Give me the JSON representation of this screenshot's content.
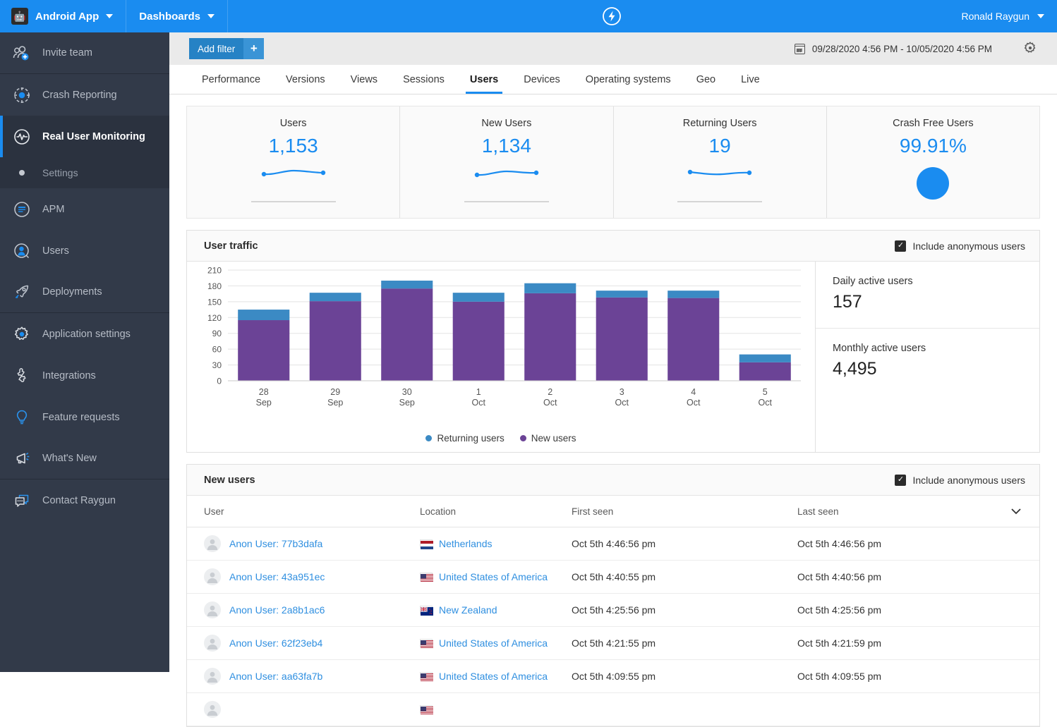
{
  "topbar": {
    "app_name": "Android App",
    "dashboards_label": "Dashboards",
    "user_name": "Ronald Raygun",
    "brand_color": "#1a8cf0"
  },
  "sidebar": {
    "invite": {
      "label": "Invite team",
      "icon": "invite-team-icon"
    },
    "items": [
      {
        "label": "Crash Reporting",
        "icon": "crash-reporting-icon",
        "active": false
      },
      {
        "label": "Real User Monitoring",
        "icon": "rum-icon",
        "active": true
      },
      {
        "label": "Settings",
        "icon": "dot-icon",
        "active": false,
        "sub": true
      },
      {
        "label": "APM",
        "icon": "apm-icon",
        "active": false
      },
      {
        "label": "Users",
        "icon": "users-icon",
        "active": false
      },
      {
        "label": "Deployments",
        "icon": "rocket-icon",
        "active": false
      },
      {
        "label": "Application settings",
        "icon": "gear-icon",
        "active": false
      },
      {
        "label": "Integrations",
        "icon": "puzzle-icon",
        "active": false
      },
      {
        "label": "Feature requests",
        "icon": "lightbulb-icon",
        "active": false
      },
      {
        "label": "What's New",
        "icon": "megaphone-icon",
        "active": false
      },
      {
        "label": "Contact Raygun",
        "icon": "chat-icon",
        "active": false
      }
    ]
  },
  "filterbar": {
    "add_filter_label": "Add filter",
    "add_filter_plus": "+",
    "date_range": "09/28/2020 4:56 PM - 10/05/2020 4:56 PM"
  },
  "tabs": [
    {
      "label": "Performance",
      "active": false
    },
    {
      "label": "Versions",
      "active": false
    },
    {
      "label": "Views",
      "active": false
    },
    {
      "label": "Sessions",
      "active": false
    },
    {
      "label": "Users",
      "active": true
    },
    {
      "label": "Devices",
      "active": false
    },
    {
      "label": "Operating systems",
      "active": false
    },
    {
      "label": "Geo",
      "active": false
    },
    {
      "label": "Live",
      "active": false
    }
  ],
  "kpis": [
    {
      "label": "Users",
      "value": "1,153",
      "viz": "sparkline"
    },
    {
      "label": "New Users",
      "value": "1,134",
      "viz": "sparkline"
    },
    {
      "label": "Returning Users",
      "value": "19",
      "viz": "sparkline"
    },
    {
      "label": "Crash Free Users",
      "value": "99.91%",
      "viz": "donut"
    }
  ],
  "user_traffic": {
    "title": "User traffic",
    "include_anon_label": "Include anonymous users",
    "include_anon_checked": true,
    "daily_active_label": "Daily active users",
    "daily_active_value": "157",
    "monthly_active_label": "Monthly active users",
    "monthly_active_value": "4,495"
  },
  "chart_data": {
    "type": "bar",
    "stacked": true,
    "title": "User traffic",
    "xlabel": "",
    "ylabel": "",
    "ylim": [
      0,
      210
    ],
    "yticks": [
      0,
      30,
      60,
      90,
      120,
      150,
      180,
      210
    ],
    "grid": true,
    "legend_position": "bottom",
    "categories": [
      "28 Sep",
      "29 Sep",
      "30 Sep",
      "1 Oct",
      "2 Oct",
      "3 Oct",
      "4 Oct",
      "5 Oct"
    ],
    "category_lines": [
      [
        "28",
        "Sep"
      ],
      [
        "29",
        "Sep"
      ],
      [
        "30",
        "Sep"
      ],
      [
        "1",
        "Oct"
      ],
      [
        "2",
        "Oct"
      ],
      [
        "3",
        "Oct"
      ],
      [
        "4",
        "Oct"
      ],
      [
        "5",
        "Oct"
      ]
    ],
    "series": [
      {
        "name": "New users",
        "color": "#6b4396",
        "values": [
          115,
          151,
          175,
          150,
          166,
          158,
          157,
          35
        ]
      },
      {
        "name": "Returning users",
        "color": "#3b8ac4",
        "values": [
          20,
          16,
          15,
          17,
          19,
          13,
          14,
          15
        ]
      }
    ],
    "totals": [
      135,
      167,
      190,
      167,
      185,
      171,
      171,
      50
    ]
  },
  "new_users": {
    "title": "New users",
    "include_anon_label": "Include anonymous users",
    "include_anon_checked": true,
    "columns": [
      "User",
      "Location",
      "First seen",
      "Last seen"
    ],
    "rows": [
      {
        "user": "Anon User: 77b3dafa",
        "location": "Netherlands",
        "flag": "nl",
        "first_seen": "Oct 5th 4:46:56 pm",
        "last_seen": "Oct 5th 4:46:56 pm"
      },
      {
        "user": "Anon User: 43a951ec",
        "location": "United States of America",
        "flag": "us",
        "first_seen": "Oct 5th 4:40:55 pm",
        "last_seen": "Oct 5th 4:40:56 pm"
      },
      {
        "user": "Anon User: 2a8b1ac6",
        "location": "New Zealand",
        "flag": "nz",
        "first_seen": "Oct 5th 4:25:56 pm",
        "last_seen": "Oct 5th 4:25:56 pm"
      },
      {
        "user": "Anon User: 62f23eb4",
        "location": "United States of America",
        "flag": "us",
        "first_seen": "Oct 5th 4:21:55 pm",
        "last_seen": "Oct 5th 4:21:59 pm"
      },
      {
        "user": "Anon User: aa63fa7b",
        "location": "United States of America",
        "flag": "us",
        "first_seen": "Oct 5th 4:09:55 pm",
        "last_seen": "Oct 5th 4:09:55 pm"
      }
    ]
  }
}
